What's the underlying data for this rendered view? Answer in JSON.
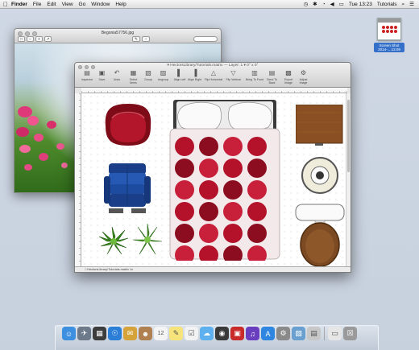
{
  "menubar": {
    "apple": "",
    "items": [
      "Finder",
      "File",
      "Edit",
      "View",
      "Go",
      "Window",
      "Help"
    ],
    "clock": "Tue 13:23",
    "user": "Tutorials"
  },
  "desktop_icon": {
    "label": "Screen Shot 2014-....13.09"
  },
  "photo_window": {
    "title": "Begonia57756.jpg",
    "tools_left": [
      "□",
      "−",
      "+",
      "↗"
    ],
    "tools_right": [
      "✎",
      "↑"
    ]
  },
  "main_window": {
    "title": "▾ HectorsLibrary/Tutorials.matrix — Layer: 1 ▾ 0° x 0°",
    "toolbar": [
      {
        "icon": "inspector-icon",
        "glyph": "▤",
        "label": "Inspector"
      },
      {
        "icon": "save-icon",
        "glyph": "▣",
        "label": "Save"
      },
      {
        "icon": "undo-icon",
        "glyph": "↶",
        "label": "Undo"
      },
      {
        "icon": "select-items-icon",
        "glyph": "▦",
        "label": "Select Items"
      },
      {
        "icon": "group-icon",
        "glyph": "▧",
        "label": "Group"
      },
      {
        "icon": "ungroup-icon",
        "glyph": "▨",
        "label": "Ungroup"
      },
      {
        "icon": "align-left-icon",
        "glyph": "▌",
        "label": "Align Left"
      },
      {
        "icon": "align-right-icon",
        "glyph": "▐",
        "label": "Align Right"
      },
      {
        "icon": "flip-horizontal-icon",
        "glyph": "△",
        "label": "Flip Horizontal"
      },
      {
        "icon": "flip-vertical-icon",
        "glyph": "▽",
        "label": "Flip Vertical"
      },
      {
        "icon": "bring-to-front-icon",
        "glyph": "▥",
        "label": "Bring To Front"
      },
      {
        "icon": "send-to-back-icon",
        "glyph": "▤",
        "label": "Send To Back"
      },
      {
        "icon": "export-image-icon",
        "glyph": "▩",
        "label": "Export Image"
      },
      {
        "icon": "adjust-image-icon",
        "glyph": "⚙",
        "label": "Adjust Image"
      }
    ],
    "status_text": "□ HectorsLibrary/Tutorials.matrix    1x"
  },
  "colors": {
    "chair_red": "#9a1020",
    "sofa_blue": "#1f4fa8",
    "duvet_red": "#b4122a",
    "wood": "#8a4f22"
  },
  "dock": {
    "icons": [
      "finder-icon",
      "launchpad-icon",
      "mission-control-icon",
      "safari-icon",
      "mail-icon",
      "contacts-icon",
      "calendar-icon",
      "notes-icon",
      "reminders-icon",
      "messages-icon",
      "facetime-icon",
      "photo-booth-icon",
      "itunes-icon",
      "app-store-icon",
      "system-preferences-icon",
      "preview-icon",
      "floorplan-app-icon",
      "documents-icon",
      "trash-icon"
    ]
  }
}
